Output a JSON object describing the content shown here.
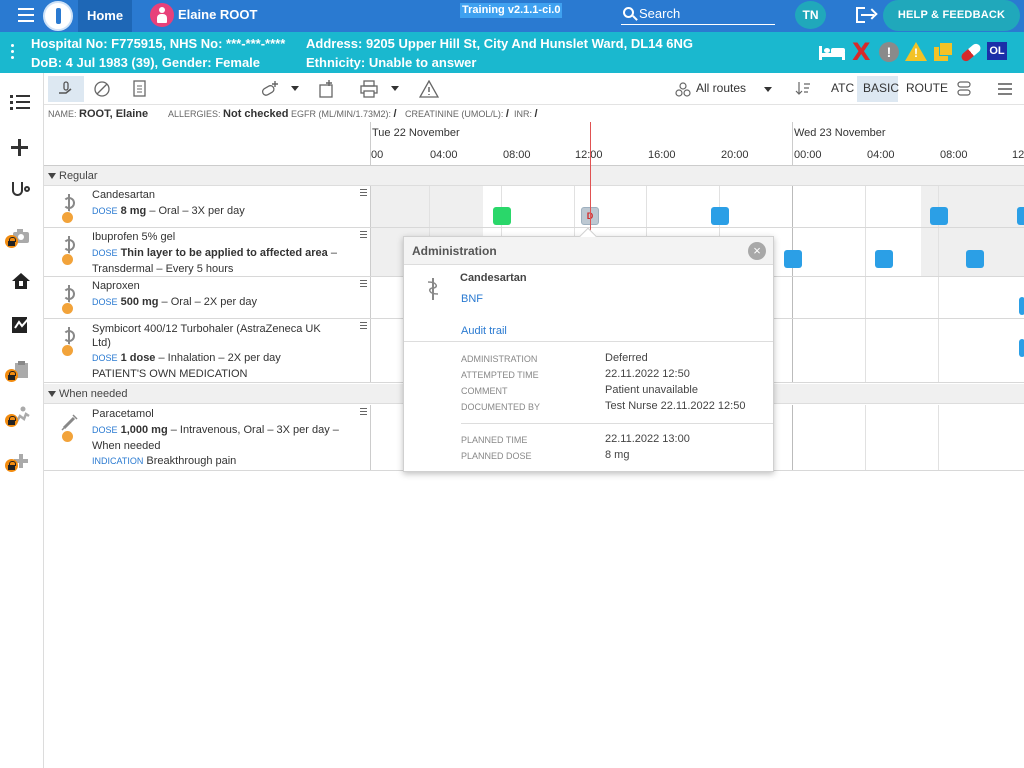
{
  "topbar": {
    "home_label": "Home",
    "patient_name": "Elaine ROOT",
    "training_label": "Training v2.1.1-ci.0",
    "search_placeholder": "Search",
    "user_initials": "TN",
    "help_label": "HELP & FEEDBACK"
  },
  "patient": {
    "line1": "Hospital No: F775915, NHS No: ***-***-****",
    "line2": "DoB: 4 Jul 1983 (39), Gender: Female",
    "address": "Address: 9205 Upper Hill St, City And Hunslet Ward, DL14 6NG",
    "ethnicity": "Ethnicity: Unable to answer",
    "badge_ol": "OL",
    "status_x": "X",
    "status_excl": "!",
    "status_warn": "!",
    "icons": [
      "bed-icon",
      "red-x-icon",
      "exclamation-icon",
      "warning-icon",
      "documents-icon",
      "pill-icon",
      "ol-badge"
    ],
    "colors": {
      "topbar": "#2a7ad1",
      "patientbar": "#1ab8cf",
      "alert_red": "#d62a2a",
      "warning": "#f3c226"
    }
  },
  "toolbar": {
    "routes_label": "All routes",
    "atc_label": "ATC",
    "basic_label": "BASIC",
    "route_label": "ROUTE"
  },
  "info": {
    "name_key": "NAME:",
    "name_value": "ROOT, Elaine",
    "allergies_key": "ALLERGIES:",
    "allergies_value": "Not checked",
    "egfr_key": "EGFR (ML/MIN/1.73M2):",
    "egfr_value": "/",
    "creatinine_key": "CREATININE (UMOL/L):",
    "creatinine_value": "/",
    "inr_key": "INR:",
    "inr_value": "/"
  },
  "timeline": {
    "day1": "Tue 22 November",
    "day2": "Wed 23 November",
    "ticks": [
      "00",
      "04:00",
      "08:00",
      "12:00",
      "16:00",
      "20:00",
      "00:00",
      "04:00",
      "08:00",
      "12"
    ]
  },
  "groups": {
    "regular": "Regular",
    "when_needed": "When needed"
  },
  "meds": [
    {
      "name": "Candesartan",
      "dose_label": "DOSE",
      "dose_bold": "8 mg",
      "dose_rest": " – Oral – 3X per day"
    },
    {
      "name": "Ibuprofen 5% gel",
      "dose_label": "DOSE",
      "dose_bold": "Thin layer to be applied to affected area",
      "dose_rest": " – Transdermal – Every 5 hours"
    },
    {
      "name": "Naproxen",
      "dose_label": "DOSE",
      "dose_bold": "500 mg",
      "dose_rest": " – Oral – 2X per day"
    },
    {
      "name": "Symbicort 400/12 Turbohaler (AstraZeneca UK Ltd)",
      "dose_label": "DOSE",
      "dose_bold": "1 dose",
      "dose_rest": " – Inhalation – 2X per day",
      "note": "PATIENT'S OWN MEDICATION"
    },
    {
      "name": "Paracetamol",
      "dose_label": "DOSE",
      "dose_bold": "1,000 mg",
      "dose_rest": " – Intravenous, Oral – 3X per day – When needed",
      "indication_label": "INDICATION",
      "indication": "Breakthrough pain"
    }
  ],
  "deferred_marker": "D",
  "popup": {
    "title": "Administration",
    "close": "×",
    "drug": "Candesartan",
    "bnf": "BNF",
    "audit": "Audit trail",
    "rows": [
      {
        "key": "ADMINISTRATION",
        "value": "Deferred"
      },
      {
        "key": "ATTEMPTED TIME",
        "value": "22.11.2022 12:50"
      },
      {
        "key": "COMMENT",
        "value": "Patient unavailable"
      },
      {
        "key": "DOCUMENTED BY",
        "value": "Test Nurse 22.11.2022 12:50"
      },
      {
        "key": "PLANNED TIME",
        "value": "22.11.2022 13:00"
      },
      {
        "key": "PLANNED DOSE",
        "value": "8 mg"
      }
    ]
  }
}
